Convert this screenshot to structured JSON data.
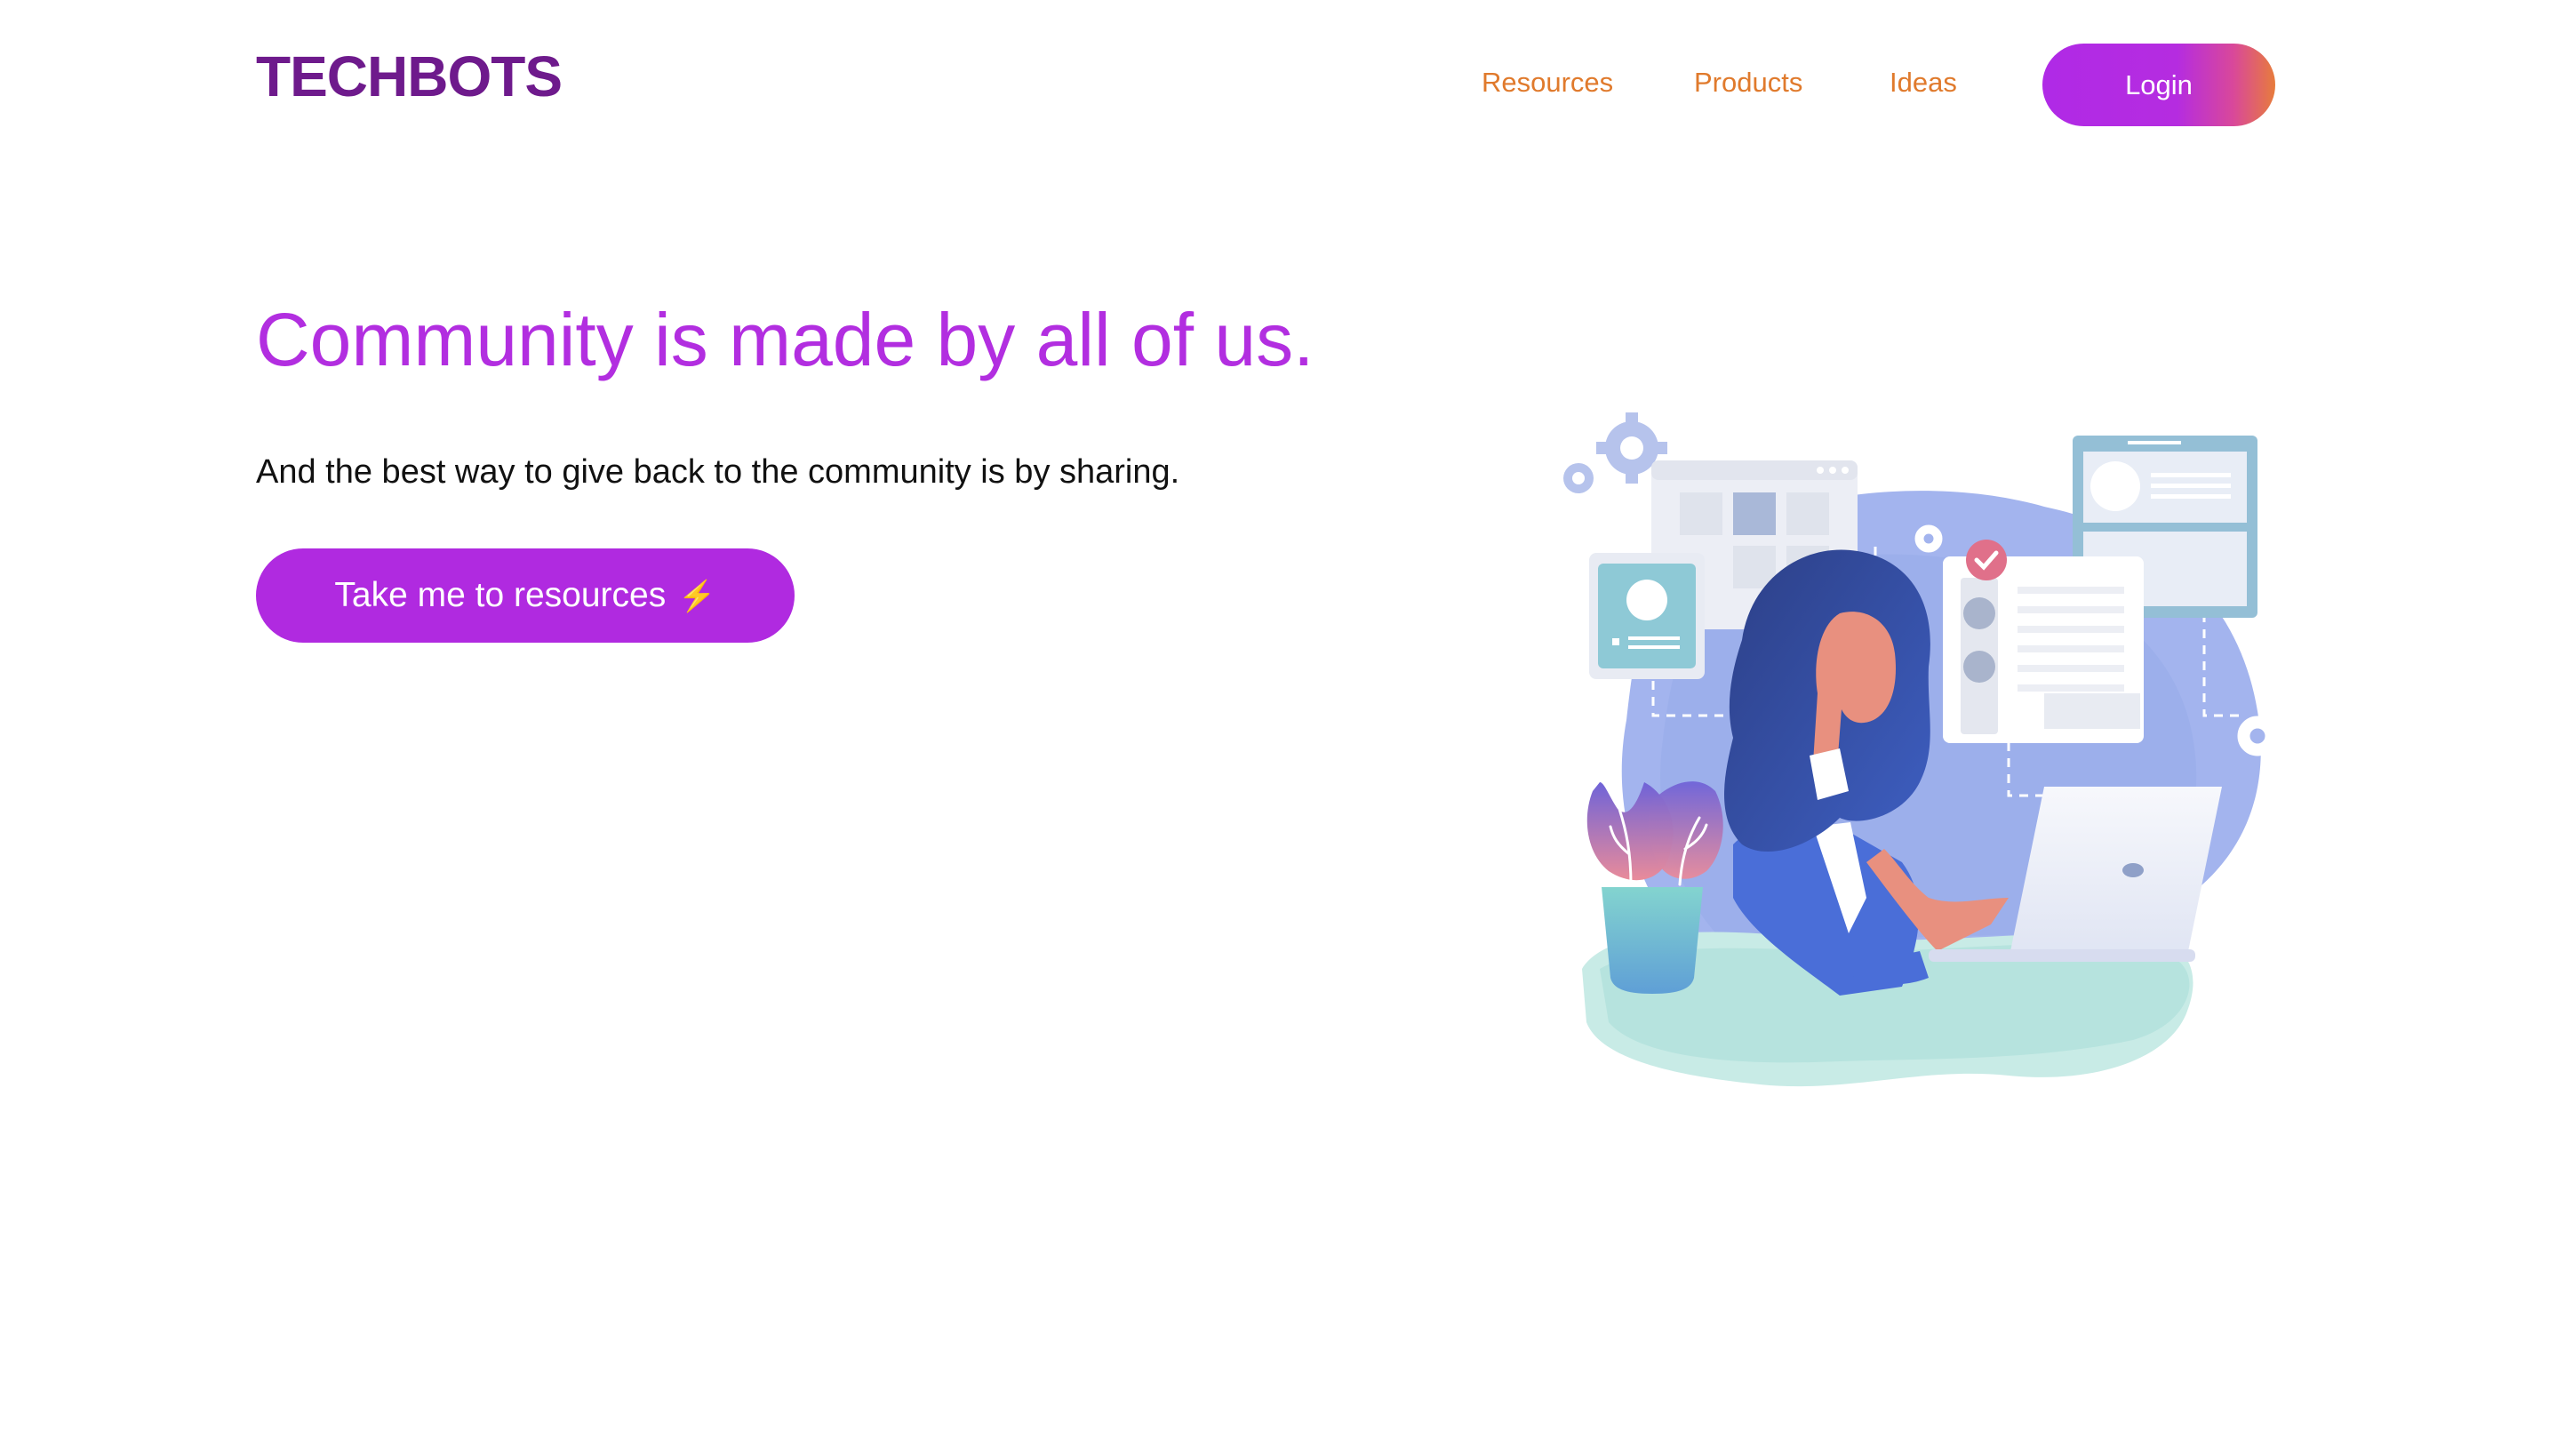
{
  "brand": {
    "logo": "TECHBOTS"
  },
  "nav": {
    "items": [
      "Resources",
      "Products",
      "Ideas"
    ],
    "login_label": "Login"
  },
  "hero": {
    "headline": "Community is made by all of us.",
    "subtext": "And the best way to give back to the community is by sharing.",
    "cta_label": "Take me to resources",
    "cta_icon": "⚡",
    "illustration": "woman-at-laptop-illustration"
  },
  "colors": {
    "brand_purple": "#6e1a8c",
    "accent_purple": "#b02ae0",
    "nav_orange": "#e07a2c"
  }
}
